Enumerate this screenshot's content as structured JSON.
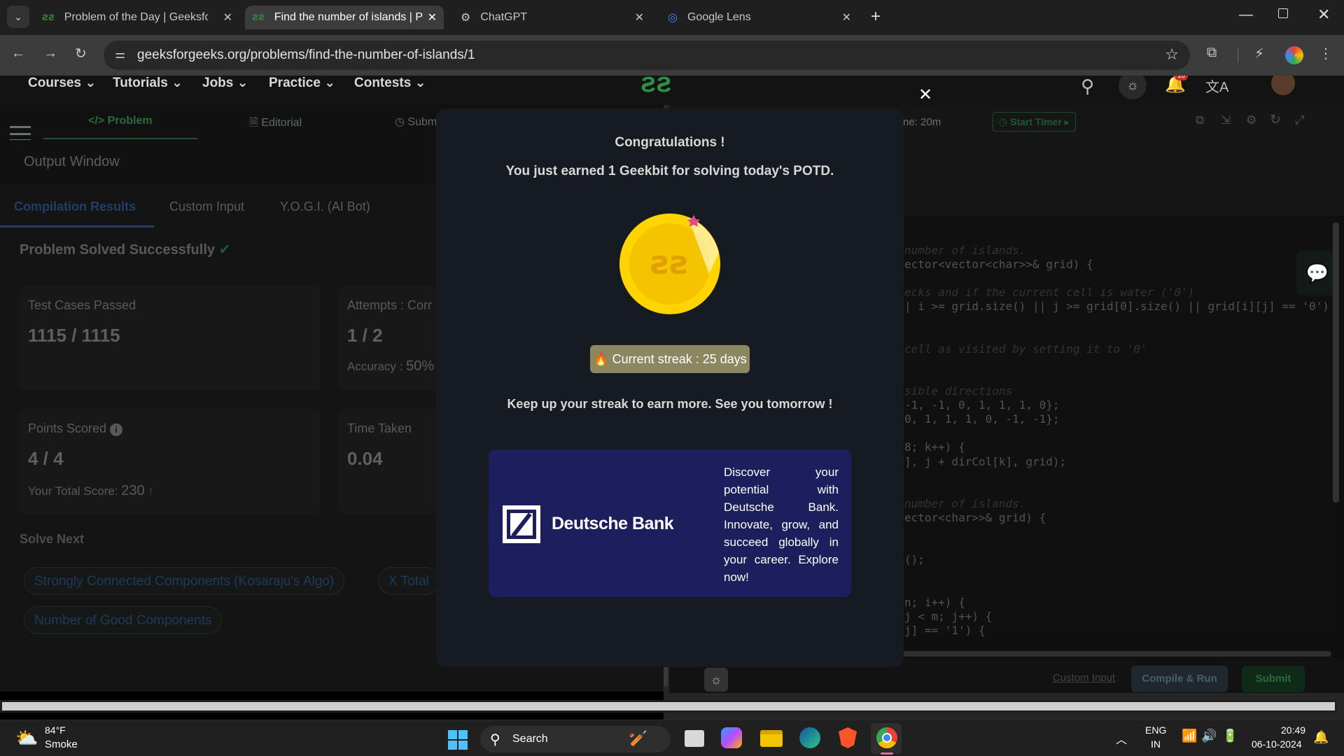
{
  "tabs": [
    {
      "title": "Problem of the Day | GeeksforG",
      "active": false
    },
    {
      "title": "Find the number of islands | Pra",
      "active": true
    },
    {
      "title": "ChatGPT",
      "active": false
    },
    {
      "title": "Google Lens",
      "active": false
    }
  ],
  "address": {
    "url": "geeksforgeeks.org/problems/find-the-number-of-islands/1"
  },
  "nav": {
    "items": [
      "Courses",
      "Tutorials",
      "Jobs",
      "Practice",
      "Contests"
    ],
    "notif_count": "10"
  },
  "problem_tabs": [
    "Problem",
    "Editorial",
    "Subm"
  ],
  "timer": {
    "label": "ne: 20m",
    "start_label": "Start Timer"
  },
  "left": {
    "output_window": "Output Window",
    "result_tabs": [
      "Compilation Results",
      "Custom Input",
      "Y.O.G.I. (AI Bot)"
    ],
    "status": "Problem Solved Successfully",
    "test_cases_label": "Test Cases Passed",
    "test_cases_value": "1115 / 1115",
    "attempts_label": "Attempts : Corr",
    "attempts_value": "1 / 2",
    "accuracy_label": "Accuracy :",
    "accuracy_value": "50%",
    "points_label": "Points Scored",
    "points_value": "4 / 4",
    "total_score_label": "Your Total Score:",
    "total_score_value": "230",
    "time_label": "Time Taken",
    "time_value": "0.04",
    "solve_next": "Solve Next",
    "next_problems": [
      "Strongly Connected Components (Kosaraju's Algo)",
      "X Total",
      "Number of Good Components"
    ]
  },
  "code_lines": [
    {
      "text": "number of islands.",
      "comment": true
    },
    {
      "text": "ector<vector<char>>& grid) {",
      "comment": false
    },
    {
      "text": "",
      "comment": false
    },
    {
      "text": "ecks and if the current cell is water ('0')",
      "comment": true
    },
    {
      "text": "| i >= grid.size() || j >= grid[0].size() || grid[i][j] == '0')",
      "comment": false
    },
    {
      "text": "",
      "comment": false
    },
    {
      "text": "",
      "comment": false
    },
    {
      "text": "cell as visited by setting it to '0'",
      "comment": true
    },
    {
      "text": "",
      "comment": false
    },
    {
      "text": "",
      "comment": false
    },
    {
      "text": "sible directions",
      "comment": true
    },
    {
      "text": "-1, -1, 0, 1, 1, 1, 0};",
      "comment": false
    },
    {
      "text": "0, 1, 1, 1, 0, -1, -1};",
      "comment": false
    },
    {
      "text": "",
      "comment": false
    },
    {
      "text": "8; k++) {",
      "comment": false
    },
    {
      "text": "], j + dirCol[k], grid);",
      "comment": false
    },
    {
      "text": "",
      "comment": false
    },
    {
      "text": "",
      "comment": false
    },
    {
      "text": "number of islands.",
      "comment": true
    },
    {
      "text": "ector<char>>& grid) {",
      "comment": false
    },
    {
      "text": "",
      "comment": false
    },
    {
      "text": "",
      "comment": false
    },
    {
      "text": "();",
      "comment": false
    },
    {
      "text": "",
      "comment": false
    },
    {
      "text": "",
      "comment": false
    },
    {
      "text": "n; i++) {",
      "comment": false
    },
    {
      "text": "j < m; j++) {",
      "comment": false
    },
    {
      "text": "j] == '1') {",
      "comment": false
    }
  ],
  "editor_actions": {
    "custom_input": "Custom Input",
    "compile_run": "Compile & Run",
    "submit": "Submit"
  },
  "modal": {
    "title": "Congratulations !",
    "subtitle": "You just earned 1 Geekbit for solving today's POTD.",
    "streak": "Current streak : 25 days",
    "keep_up": "Keep up your streak to earn more. See you tomorrow !",
    "ad": {
      "brand": "Deutsche Bank",
      "text": "Discover your potential with Deutsche Bank. Innovate, grow, and succeed globally in your career. Explore now!"
    },
    "colors": {
      "coin": "#f5c400",
      "ad_bg": "#1c1f5c",
      "streak_bg": "#8b8761"
    }
  },
  "taskbar": {
    "weather_temp": "84°F",
    "weather_desc": "Smoke",
    "search_label": "Search",
    "lang_top": "ENG",
    "lang_bottom": "IN",
    "time": "20:49",
    "date": "06-10-2024"
  }
}
